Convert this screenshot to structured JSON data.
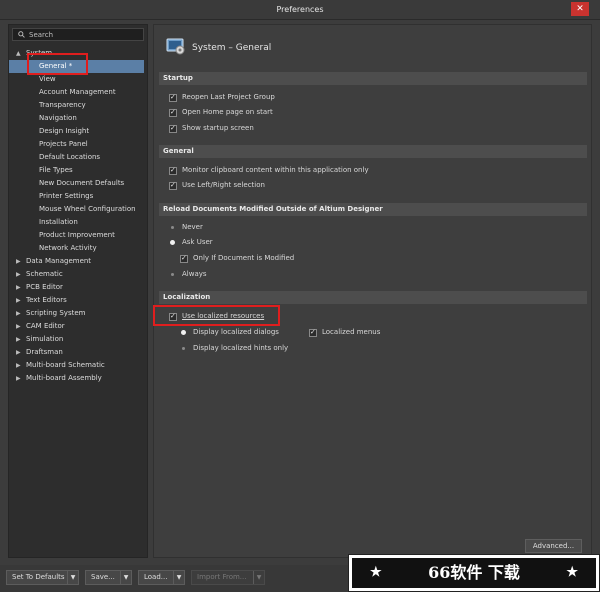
{
  "window": {
    "title": "Preferences",
    "close_glyph": "✕"
  },
  "search": {
    "placeholder": "Search"
  },
  "tree": {
    "system": {
      "label": "System",
      "expand": "▲"
    },
    "system_children": [
      "General *",
      "View",
      "Account Management",
      "Transparency",
      "Navigation",
      "Design Insight",
      "Projects Panel",
      "Default Locations",
      "File Types",
      "New Document Defaults",
      "Printer Settings",
      "Mouse Wheel Configuration",
      "Installation",
      "Product Improvement",
      "Network Activity"
    ],
    "top_items": [
      "Data Management",
      "Schematic",
      "PCB Editor",
      "Text Editors",
      "Scripting System",
      "CAM Editor",
      "Simulation",
      "Draftsman",
      "Multi-board Schematic",
      "Multi-board Assembly"
    ],
    "collapsed_arrow": "▶"
  },
  "page": {
    "title": "System – General",
    "icon": "system-general-icon"
  },
  "startup": {
    "header": "Startup",
    "reopen_last": {
      "label": "Reopen Last Project Group",
      "checked": true
    },
    "open_home": {
      "label": "Open Home page on start",
      "checked": true
    },
    "show_startup": {
      "label": "Show startup screen",
      "checked": true
    }
  },
  "general": {
    "header": "General",
    "monitor_clipboard": {
      "label": "Monitor clipboard content within this application only",
      "checked": true
    },
    "left_right": {
      "label": "Use Left/Right selection",
      "checked": true
    }
  },
  "reload": {
    "header": "Reload Documents Modified Outside of Altium Designer",
    "never": "Never",
    "ask_user": "Ask User",
    "only_if_modified": "Only If Document is Modified",
    "always": "Always",
    "selected": "Ask User"
  },
  "localization": {
    "header": "Localization",
    "use_localized": {
      "label": "Use localized resources",
      "checked": true
    },
    "display_dialogs": "Display localized dialogs",
    "localized_menus": {
      "label": "Localized menus",
      "checked": true
    },
    "display_hints": "Display localized hints only",
    "selected": "Display localized dialogs"
  },
  "buttons": {
    "advanced": "Advanced...",
    "set_defaults": "Set To Defaults",
    "save": "Save...",
    "load": "Load...",
    "import_from": "Import From..."
  },
  "watermark": {
    "text": "66软件 下载",
    "star": "★"
  },
  "colors": {
    "selection": "#5b7fa6",
    "highlight_box": "#e01e1e",
    "close": "#c9332f"
  }
}
